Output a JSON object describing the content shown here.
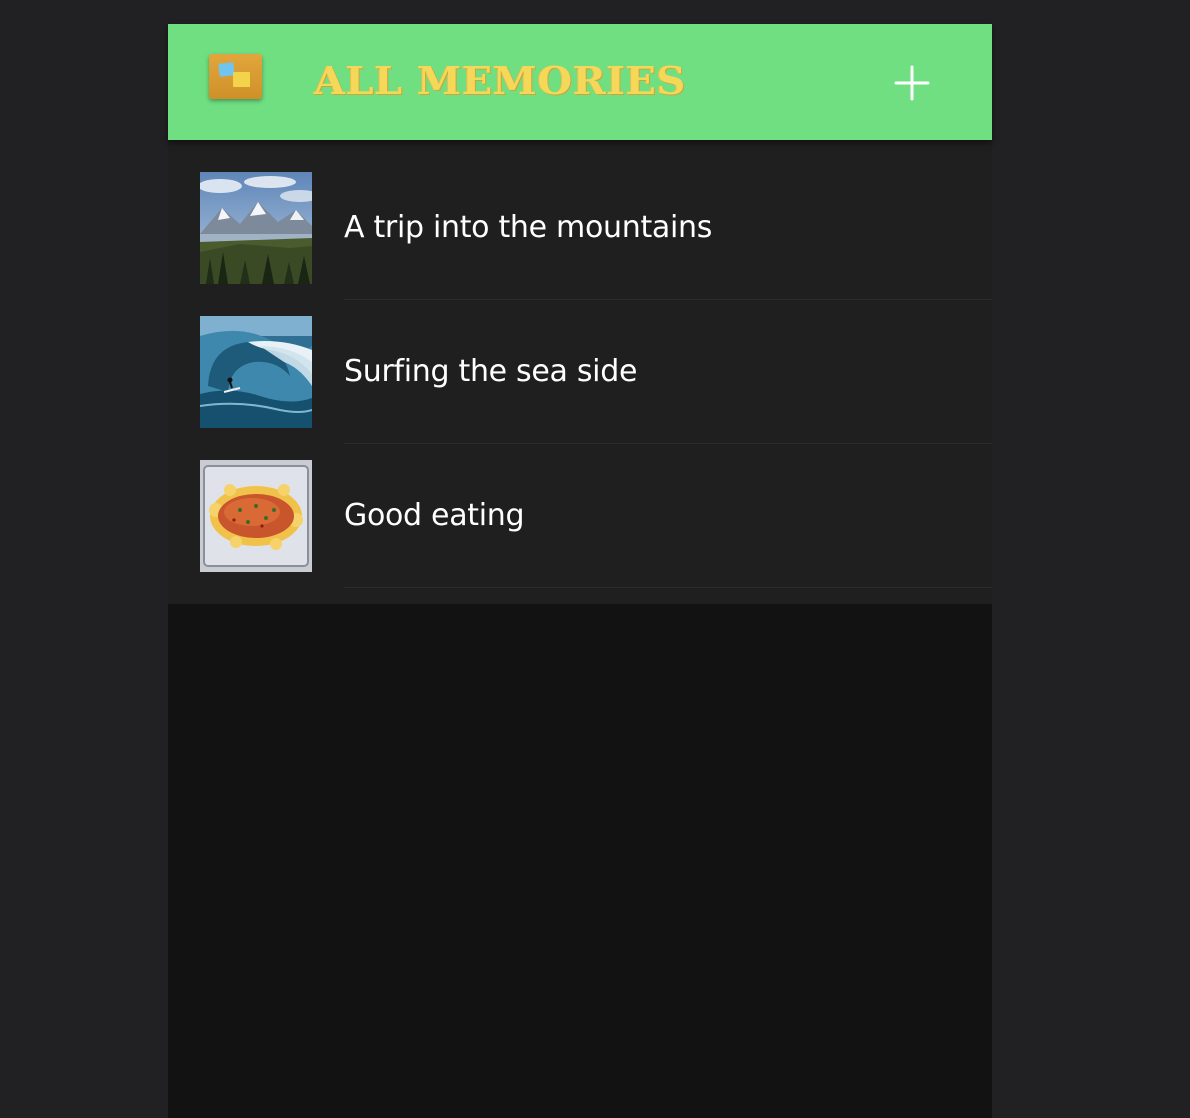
{
  "header": {
    "logo_icon": "sticky-notes-icon",
    "title": "ALL MEMORIES",
    "add_icon": "plus-icon",
    "colors": {
      "background": "#6fdf82",
      "title": "#f5d85a"
    }
  },
  "memories": [
    {
      "title": "A trip into the mountains",
      "thumbnail": "mountain-landscape-image"
    },
    {
      "title": "Surfing the sea side",
      "thumbnail": "surfing-wave-image"
    },
    {
      "title": "Good eating",
      "thumbnail": "baked-salmon-dish-image"
    }
  ]
}
